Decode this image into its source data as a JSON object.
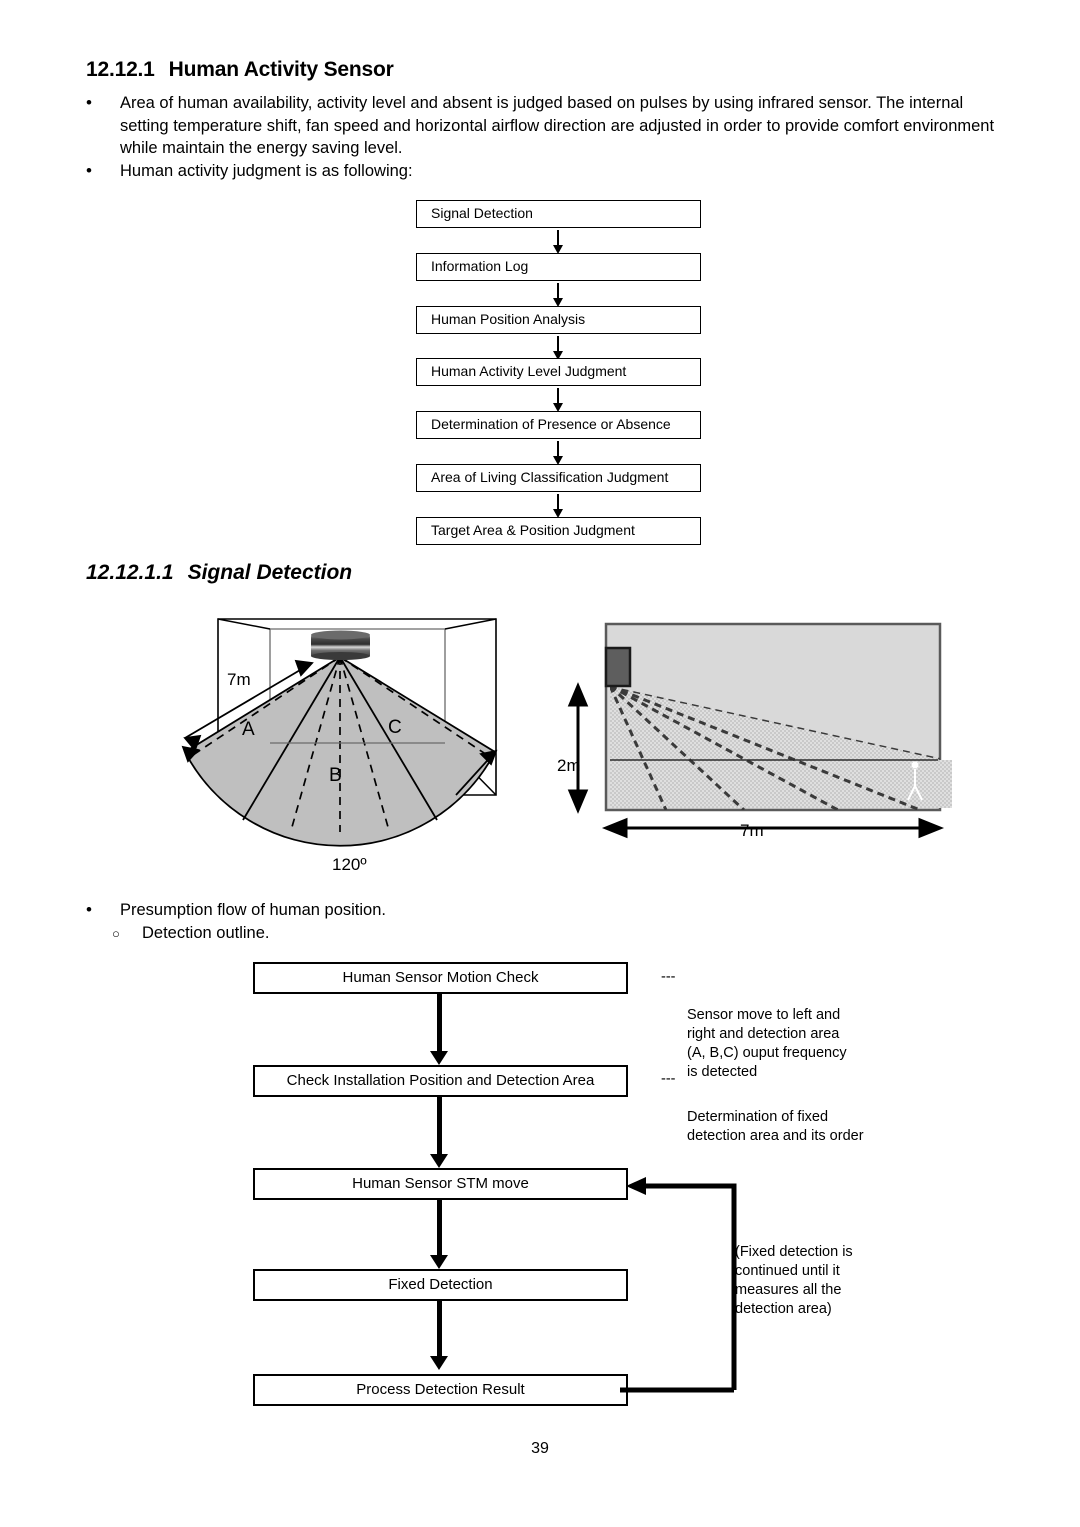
{
  "document": {
    "page_number": "39"
  },
  "section": {
    "number": "12.12.1",
    "title": "Human Activity Sensor"
  },
  "intro_bullets": [
    {
      "marker": "•",
      "text": "Area of human availability, activity level and absent is judged based on pulses by using infrared sensor. The internal setting temperature shift, fan speed and horizontal airflow direction are adjusted in order to provide comfort environment while maintain the energy saving level."
    },
    {
      "marker": "•",
      "text": "Human activity judgment is as following:"
    }
  ],
  "judgment_flow": {
    "steps": [
      "Signal Detection",
      "Information Log",
      "Human Position Analysis",
      "Human Activity Level Judgment",
      "Determination of Presence or Absence",
      "Area of Living Classification Judgment",
      "Target Area & Position Judgment"
    ]
  },
  "subsection": {
    "number": "12.12.1.1",
    "title": "Signal Detection"
  },
  "coverage_diagram_3d": {
    "distance_label": "7m",
    "angle_label": "120º",
    "zones": [
      "A",
      "B",
      "C"
    ],
    "icon": "ceiling-sensor-icon"
  },
  "coverage_diagram_side": {
    "height_label": "2m",
    "distance_label": "7m",
    "icon": "wall-sensor-icon"
  },
  "flow_bullets": [
    {
      "marker": "•",
      "text": "Presumption flow of human position."
    },
    {
      "marker": "○",
      "text": "Detection outline."
    }
  ],
  "detection_flow": {
    "steps": [
      "Human Sensor Motion Check",
      "Check Installation Position and Detection Area",
      "Human Sensor STM move",
      "Fixed Detection",
      "Process Detection Result"
    ],
    "annotations": [
      {
        "dash": "---",
        "text": "Sensor move to left and\nright and detection area\n(A, B,C) ouput frequency\nis detected"
      },
      {
        "dash": "---",
        "text": "Determination of fixed\ndetection area and its order"
      }
    ],
    "loop_note": "(Fixed detection is\ncontinued until it\nmeasures all the\ndetection area)"
  }
}
